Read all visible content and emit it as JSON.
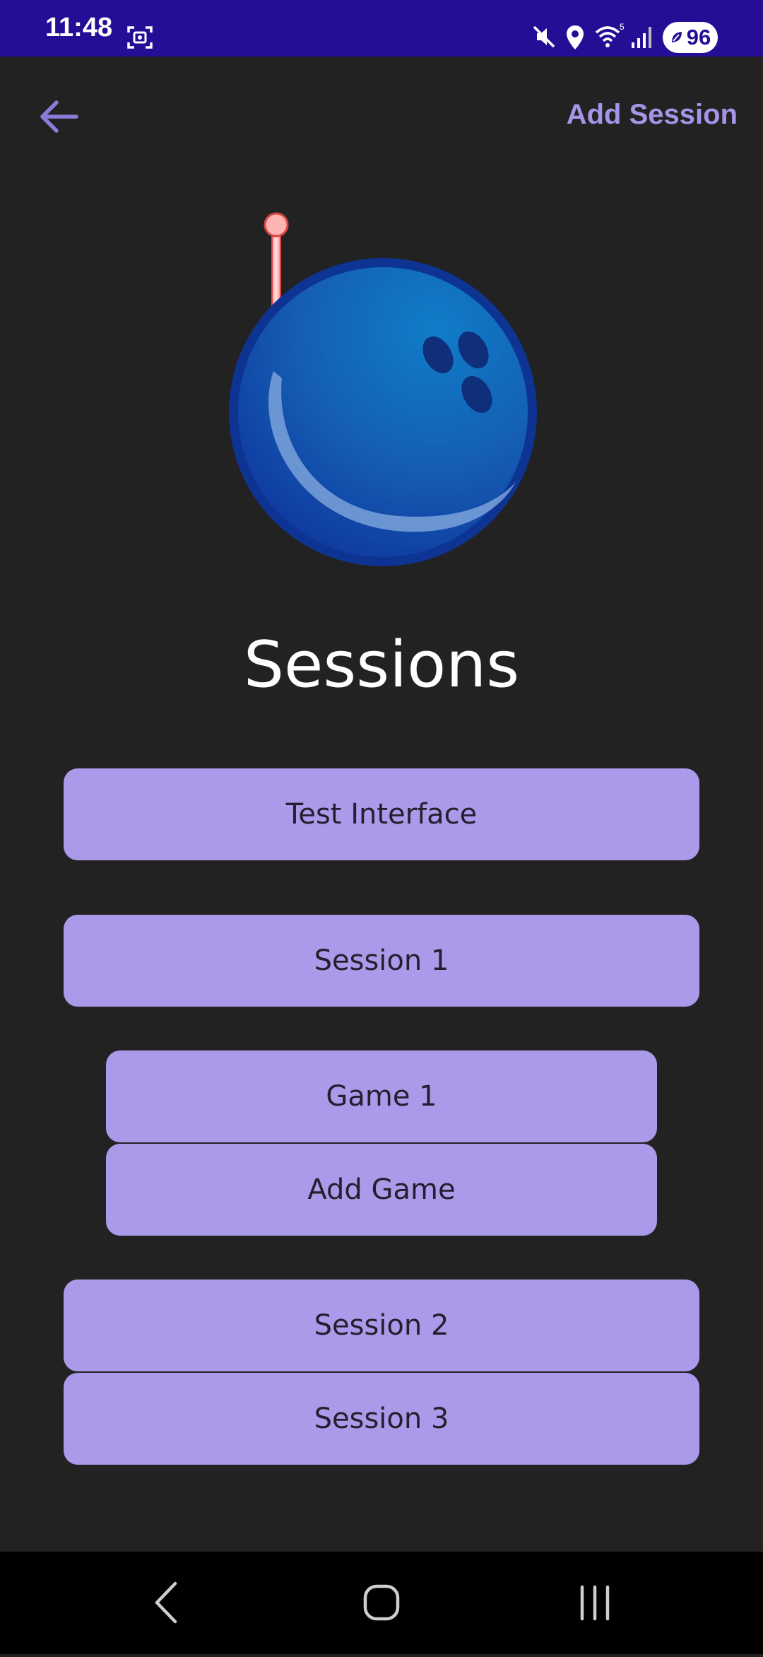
{
  "status_bar": {
    "time": "11:48",
    "battery": "96",
    "background": "#240e95",
    "icons": [
      "screenshot-icon",
      "mute-icon",
      "location-icon",
      "wifi-icon",
      "signal-icon",
      "battery-saver-icon"
    ]
  },
  "app_bar": {
    "back_icon": "arrow-back-icon",
    "add_session_label": "Add Session",
    "accent": "#a694e8"
  },
  "main": {
    "hero_icon": "bowling-ball-icon",
    "title": "Sessions",
    "button_color": "#aa9ae9",
    "items": [
      {
        "label": "Test Interface"
      },
      {
        "label": "Session 1"
      },
      {
        "label": "Game 1"
      },
      {
        "label": "Add Game"
      },
      {
        "label": "Session 2"
      },
      {
        "label": "Session 3"
      }
    ]
  },
  "nav_bar": {
    "icons": [
      "nav-back-icon",
      "nav-home-icon",
      "nav-recents-icon"
    ]
  }
}
